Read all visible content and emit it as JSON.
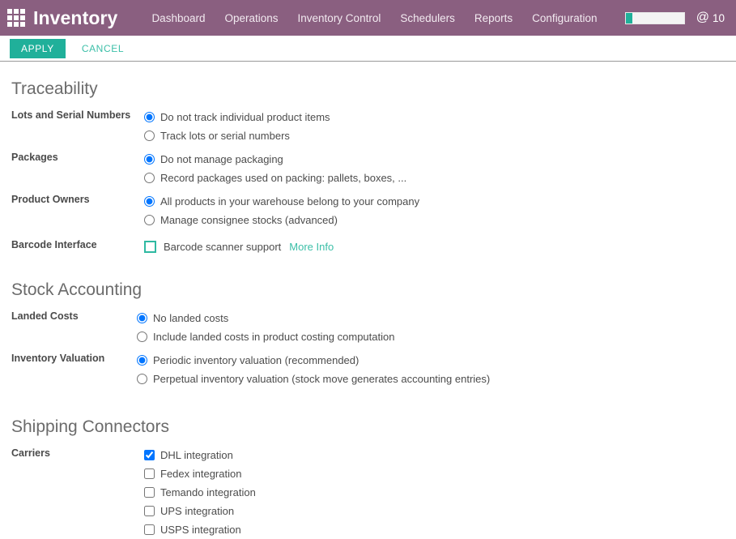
{
  "topbar": {
    "apps_icon": "apps-grid-icon",
    "brand": "Inventory",
    "nav": [
      {
        "label": "Dashboard"
      },
      {
        "label": "Operations"
      },
      {
        "label": "Inventory Control"
      },
      {
        "label": "Schedulers"
      },
      {
        "label": "Reports"
      },
      {
        "label": "Configuration"
      }
    ],
    "progress": {
      "percent": 11
    },
    "user": {
      "icon": "at-icon",
      "glyph": "@",
      "label": "10"
    },
    "colors": {
      "header_bg": "#8a5f80",
      "accent": "#20b09a"
    }
  },
  "toolbar": {
    "apply_label": "APPLY",
    "cancel_label": "CANCEL"
  },
  "sections": [
    {
      "title": "Traceability",
      "rows": [
        {
          "label": "Lots and Serial Numbers",
          "options": [
            {
              "label": "Do not track individual product items",
              "type": "radio",
              "checked": true
            },
            {
              "label": "Track lots or serial numbers",
              "type": "radio",
              "checked": false
            }
          ]
        },
        {
          "label": "Packages",
          "options": [
            {
              "label": "Do not manage packaging",
              "type": "radio",
              "checked": true
            },
            {
              "label": "Record packages used on packing: pallets, boxes, ...",
              "type": "radio",
              "checked": false
            }
          ]
        },
        {
          "label": "Product Owners",
          "options": [
            {
              "label": "All products in your warehouse belong to your company",
              "type": "radio",
              "checked": true
            },
            {
              "label": "Manage consignee stocks (advanced)",
              "type": "radio",
              "checked": false
            }
          ]
        },
        {
          "label": "Barcode Interface",
          "options": [
            {
              "label": "Barcode scanner support",
              "type": "checkbox-accent",
              "checked": false,
              "link": "More Info"
            }
          ]
        }
      ]
    },
    {
      "title": "Stock Accounting",
      "rows": [
        {
          "label": "Landed Costs",
          "options": [
            {
              "label": "No landed costs",
              "type": "radio",
              "checked": true
            },
            {
              "label": "Include landed costs in product costing computation",
              "type": "radio",
              "checked": false
            }
          ]
        },
        {
          "label": "Inventory Valuation",
          "options": [
            {
              "label": "Periodic inventory valuation (recommended)",
              "type": "radio",
              "checked": true
            },
            {
              "label": "Perpetual inventory valuation (stock move generates accounting entries)",
              "type": "radio",
              "checked": false
            }
          ]
        }
      ]
    },
    {
      "title": "Shipping Connectors",
      "rows": [
        {
          "label": "Carriers",
          "options": [
            {
              "label": "DHL integration",
              "type": "checkbox",
              "checked": true
            },
            {
              "label": "Fedex integration",
              "type": "checkbox",
              "checked": false
            },
            {
              "label": "Temando integration",
              "type": "checkbox",
              "checked": false
            },
            {
              "label": "UPS integration",
              "type": "checkbox",
              "checked": false
            },
            {
              "label": "USPS integration",
              "type": "checkbox",
              "checked": false
            }
          ]
        }
      ]
    }
  ]
}
